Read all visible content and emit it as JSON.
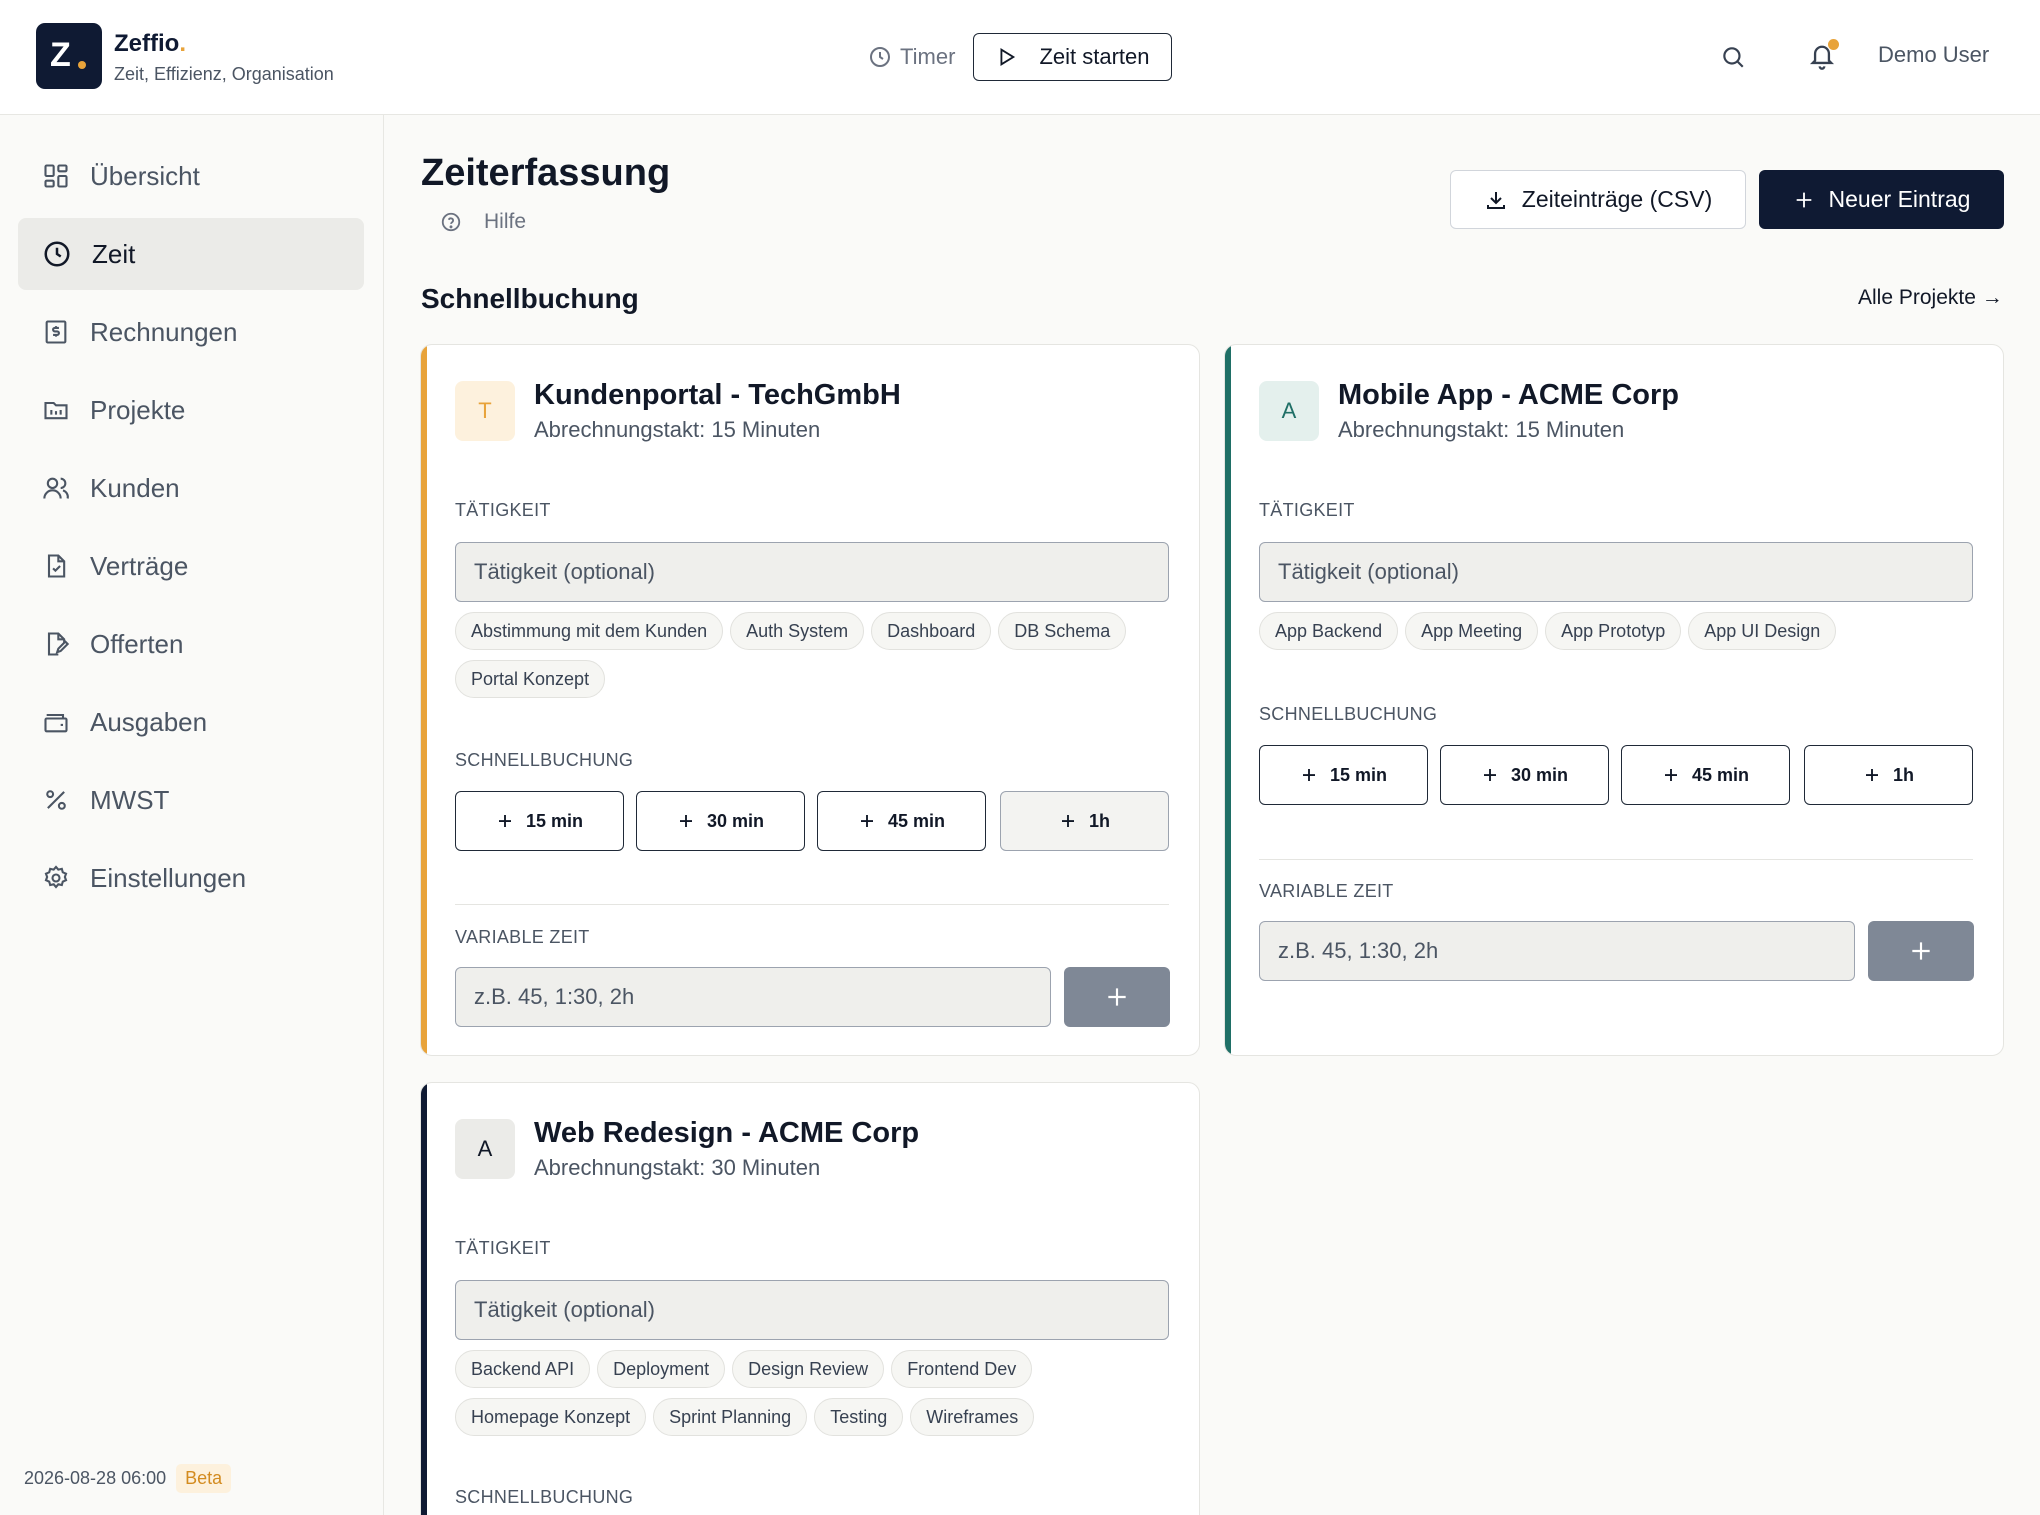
{
  "app": {
    "name": "Zeffio",
    "tagline": "Zeit, Effizienz, Organisation",
    "logo_letter": "Z",
    "brand_dot": "."
  },
  "header": {
    "timer_label": "Timer",
    "start_label": "Zeit starten",
    "user_name": "Demo User"
  },
  "sidebar": {
    "items": [
      {
        "label": "Übersicht",
        "icon": "grid-icon"
      },
      {
        "label": "Zeit",
        "icon": "clock-icon",
        "active": true
      },
      {
        "label": "Rechnungen",
        "icon": "invoice-icon"
      },
      {
        "label": "Projekte",
        "icon": "folder-icon"
      },
      {
        "label": "Kunden",
        "icon": "users-icon"
      },
      {
        "label": "Verträge",
        "icon": "contract-icon"
      },
      {
        "label": "Offerten",
        "icon": "offer-icon"
      },
      {
        "label": "Ausgaben",
        "icon": "wallet-icon"
      },
      {
        "label": "MWST",
        "icon": "percent-icon"
      },
      {
        "label": "Einstellungen",
        "icon": "gear-icon"
      }
    ],
    "footer_date": "2026-08-28 06:00",
    "footer_badge": "Beta"
  },
  "page": {
    "title": "Zeiterfassung",
    "help_label": "Hilfe",
    "csv_label": "Zeiteinträge (CSV)",
    "new_label": "Neuer Eintrag",
    "section_title": "Schnellbuchung",
    "all_projects": "Alle Projekte →"
  },
  "labels": {
    "activity": "TÄTIGKEIT",
    "activity_placeholder": "Tätigkeit (optional)",
    "quick": "SCHNELLBUCHUNG",
    "variable": "VARIABLE ZEIT",
    "variable_placeholder": "z.B. 45, 1:30, 2h"
  },
  "quick_options": [
    "15 min",
    "30 min",
    "45 min",
    "1h"
  ],
  "projects": [
    {
      "initial": "T",
      "name": "Kundenportal - TechGmbH",
      "billing": "Abrechnungstakt: 15 Minuten",
      "accent": "#e8a33a",
      "activities": [
        "Abstimmung mit dem Kunden",
        "Auth System",
        "Dashboard",
        "DB Schema",
        "Portal Konzept"
      ]
    },
    {
      "initial": "A",
      "name": "Mobile App - ACME Corp",
      "billing": "Abrechnungstakt: 15 Minuten",
      "accent": "#1f6f66",
      "activities": [
        "App Backend",
        "App Meeting",
        "App Prototyp",
        "App UI Design"
      ]
    },
    {
      "initial": "A",
      "name": "Web Redesign - ACME Corp",
      "billing": "Abrechnungstakt: 30 Minuten",
      "accent": "#0f1a33",
      "activities": [
        "Backend API",
        "Deployment",
        "Design Review",
        "Frontend Dev",
        "Homepage Konzept",
        "Sprint Planning",
        "Testing",
        "Wireframes"
      ]
    }
  ]
}
